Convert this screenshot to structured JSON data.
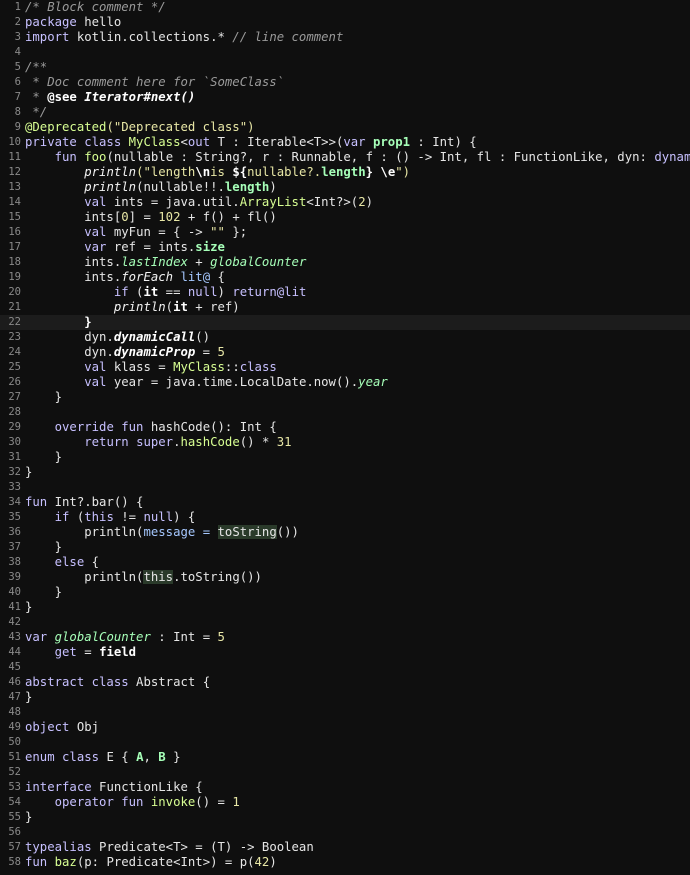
{
  "editor": {
    "current_line": 22,
    "lines": [
      [
        {
          "t": "/* Block comment */",
          "c": "cm"
        }
      ],
      [
        {
          "t": "package",
          "c": "kw"
        },
        {
          "t": " hello"
        }
      ],
      [
        {
          "t": "import",
          "c": "kw"
        },
        {
          "t": " kotlin.collections.* "
        },
        {
          "t": "// line comment",
          "c": "cm"
        }
      ],
      [],
      [
        {
          "t": "/**",
          "c": "cm"
        }
      ],
      [
        {
          "t": " * Doc comment here for `SomeClass`",
          "c": "cm"
        }
      ],
      [
        {
          "t": " * ",
          "c": "cm"
        },
        {
          "t": "@see",
          "c": "dk"
        },
        {
          "t": " ",
          "c": "cm"
        },
        {
          "t": "Iterator#next()",
          "c": "ex"
        }
      ],
      [
        {
          "t": " */",
          "c": "cm"
        }
      ],
      [
        {
          "t": "@Deprecated",
          "c": "an"
        },
        {
          "t": "(\"Deprecated class\")",
          "c": "st"
        }
      ],
      [
        {
          "t": "private class",
          "c": "kw"
        },
        {
          "t": " "
        },
        {
          "t": "MyClass",
          "c": "fn"
        },
        {
          "t": "<"
        },
        {
          "t": "out",
          "c": "kw"
        },
        {
          "t": " T : Iterable<T>>("
        },
        {
          "t": "var",
          "c": "kw"
        },
        {
          "t": " "
        },
        {
          "t": "prop1",
          "c": "pr"
        },
        {
          "t": " : Int) {"
        }
      ],
      [
        {
          "t": "    "
        },
        {
          "t": "fun",
          "c": "kw"
        },
        {
          "t": " "
        },
        {
          "t": "foo",
          "c": "fn"
        },
        {
          "t": "(nullable : String?, r : Runnable, f : () -> Int, fl : FunctionLike, dyn: "
        },
        {
          "t": "dynamic",
          "c": "kw"
        },
        {
          "t": ") {"
        }
      ],
      [
        {
          "t": "        "
        },
        {
          "t": "println",
          "c": "sfn"
        },
        {
          "t": "(\"length",
          "c": "st"
        },
        {
          "t": "\\n",
          "c": "es"
        },
        {
          "t": "is ",
          "c": "st"
        },
        {
          "t": "${",
          "c": "es"
        },
        {
          "t": "nullable?.",
          "c": "st"
        },
        {
          "t": "length",
          "c": "pr"
        },
        {
          "t": "}",
          "c": "es"
        },
        {
          "t": " ",
          "c": "st"
        },
        {
          "t": "\\e",
          "c": "es"
        },
        {
          "t": "\")",
          "c": "st"
        }
      ],
      [
        {
          "t": "        "
        },
        {
          "t": "println",
          "c": "sfn"
        },
        {
          "t": "(nullable!!."
        },
        {
          "t": "length",
          "c": "pr"
        },
        {
          "t": ")"
        }
      ],
      [
        {
          "t": "        "
        },
        {
          "t": "val",
          "c": "kw"
        },
        {
          "t": " ints = java.util."
        },
        {
          "t": "ArrayList",
          "c": "fn"
        },
        {
          "t": "<Int?>("
        },
        {
          "t": "2",
          "c": "num"
        },
        {
          "t": ")"
        }
      ],
      [
        {
          "t": "        ints["
        },
        {
          "t": "0",
          "c": "num"
        },
        {
          "t": "] = "
        },
        {
          "t": "102",
          "c": "num"
        },
        {
          "t": " + f() + fl()"
        }
      ],
      [
        {
          "t": "        "
        },
        {
          "t": "val",
          "c": "kw"
        },
        {
          "t": " myFun = { -> "
        },
        {
          "t": "\"\"",
          "c": "st"
        },
        {
          "t": " };"
        }
      ],
      [
        {
          "t": "        "
        },
        {
          "t": "var",
          "c": "kw"
        },
        {
          "t": " ref = ints."
        },
        {
          "t": "size",
          "c": "pr"
        }
      ],
      [
        {
          "t": "        ints."
        },
        {
          "t": "lastIndex",
          "c": "ext"
        },
        {
          "t": " + "
        },
        {
          "t": "globalCounter",
          "c": "gv"
        }
      ],
      [
        {
          "t": "        ints."
        },
        {
          "t": "forEach",
          "c": "sfn"
        },
        {
          "t": " "
        },
        {
          "t": "lit@",
          "c": "lb"
        },
        {
          "t": " {"
        }
      ],
      [
        {
          "t": "            "
        },
        {
          "t": "if",
          "c": "kw"
        },
        {
          "t": " ("
        },
        {
          "t": "it",
          "c": "bd"
        },
        {
          "t": " == "
        },
        {
          "t": "null",
          "c": "kw"
        },
        {
          "t": ") "
        },
        {
          "t": "return@lit",
          "c": "kw"
        }
      ],
      [
        {
          "t": "            "
        },
        {
          "t": "println",
          "c": "sfn"
        },
        {
          "t": "("
        },
        {
          "t": "it",
          "c": "bd"
        },
        {
          "t": " + ref)"
        }
      ],
      [
        {
          "t": "        "
        },
        {
          "t": "}",
          "c": "bd"
        }
      ],
      [
        {
          "t": "        dyn."
        },
        {
          "t": "dynamicCall",
          "c": "ex"
        },
        {
          "t": "()"
        }
      ],
      [
        {
          "t": "        dyn."
        },
        {
          "t": "dynamicProp",
          "c": "ex"
        },
        {
          "t": " = "
        },
        {
          "t": "5",
          "c": "num"
        }
      ],
      [
        {
          "t": "        "
        },
        {
          "t": "val",
          "c": "kw"
        },
        {
          "t": " klass = "
        },
        {
          "t": "MyClass",
          "c": "fn"
        },
        {
          "t": "::"
        },
        {
          "t": "class",
          "c": "kw"
        }
      ],
      [
        {
          "t": "        "
        },
        {
          "t": "val",
          "c": "kw"
        },
        {
          "t": " year = java.time.LocalDate.now()."
        },
        {
          "t": "year",
          "c": "ext"
        }
      ],
      [
        {
          "t": "    }"
        }
      ],
      [],
      [
        {
          "t": "    "
        },
        {
          "t": "override fun",
          "c": "kw"
        },
        {
          "t": " hashCode(): Int {"
        }
      ],
      [
        {
          "t": "        "
        },
        {
          "t": "return",
          "c": "kw"
        },
        {
          "t": " "
        },
        {
          "t": "super",
          "c": "kw"
        },
        {
          "t": "."
        },
        {
          "t": "hashCode",
          "c": "fn"
        },
        {
          "t": "() * "
        },
        {
          "t": "31",
          "c": "num"
        }
      ],
      [
        {
          "t": "    }"
        }
      ],
      [
        {
          "t": "}"
        }
      ],
      [],
      [
        {
          "t": "fun",
          "c": "kw"
        },
        {
          "t": " Int?.bar() {"
        }
      ],
      [
        {
          "t": "    "
        },
        {
          "t": "if",
          "c": "kw"
        },
        {
          "t": " ("
        },
        {
          "t": "this",
          "c": "kw"
        },
        {
          "t": " != "
        },
        {
          "t": "null",
          "c": "kw"
        },
        {
          "t": ") {"
        }
      ],
      [
        {
          "t": "        println("
        },
        {
          "t": "message = ",
          "c": "nm"
        },
        {
          "t": "toString",
          "c": "hl"
        },
        {
          "t": "())"
        }
      ],
      [
        {
          "t": "    }"
        }
      ],
      [
        {
          "t": "    "
        },
        {
          "t": "else",
          "c": "kw"
        },
        {
          "t": " {"
        }
      ],
      [
        {
          "t": "        println("
        },
        {
          "t": "this",
          "c": "hl"
        },
        {
          "t": ".toString())"
        }
      ],
      [
        {
          "t": "    }"
        }
      ],
      [
        {
          "t": "}"
        }
      ],
      [],
      [
        {
          "t": "var",
          "c": "kw"
        },
        {
          "t": " "
        },
        {
          "t": "globalCounter",
          "c": "gv"
        },
        {
          "t": " : Int = "
        },
        {
          "t": "5",
          "c": "num"
        }
      ],
      [
        {
          "t": "    "
        },
        {
          "t": "get",
          "c": "kw"
        },
        {
          "t": " = "
        },
        {
          "t": "field",
          "c": "bd"
        }
      ],
      [],
      [
        {
          "t": "abstract class",
          "c": "kw"
        },
        {
          "t": " Abstract {"
        }
      ],
      [
        {
          "t": "}"
        }
      ],
      [],
      [
        {
          "t": "object",
          "c": "kw"
        },
        {
          "t": " Obj"
        }
      ],
      [],
      [
        {
          "t": "enum class",
          "c": "kw"
        },
        {
          "t": " E { "
        },
        {
          "t": "A",
          "c": "pr"
        },
        {
          "t": ", "
        },
        {
          "t": "B",
          "c": "pr"
        },
        {
          "t": " }"
        }
      ],
      [],
      [
        {
          "t": "interface",
          "c": "kw"
        },
        {
          "t": " FunctionLike {"
        }
      ],
      [
        {
          "t": "    "
        },
        {
          "t": "operator fun",
          "c": "kw"
        },
        {
          "t": " "
        },
        {
          "t": "invoke",
          "c": "fn"
        },
        {
          "t": "() = "
        },
        {
          "t": "1",
          "c": "num"
        }
      ],
      [
        {
          "t": "}"
        }
      ],
      [],
      [
        {
          "t": "typealias",
          "c": "kw"
        },
        {
          "t": " Predicate<T> = (T) -> Boolean"
        }
      ],
      [
        {
          "t": "fun",
          "c": "kw"
        },
        {
          "t": " "
        },
        {
          "t": "baz",
          "c": "fn"
        },
        {
          "t": "(p: Predicate<Int>) = p("
        },
        {
          "t": "42",
          "c": "num"
        },
        {
          "t": ")"
        }
      ]
    ]
  }
}
